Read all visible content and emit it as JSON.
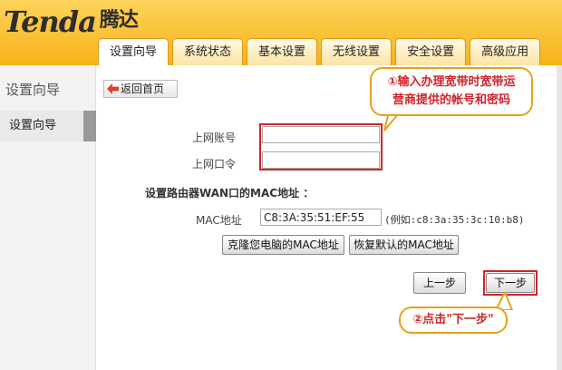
{
  "header": {
    "logo_text": "Tenda",
    "logo_cn": "腾达",
    "tabs": [
      {
        "label": "设置向导",
        "active": true
      },
      {
        "label": "系统状态"
      },
      {
        "label": "基本设置"
      },
      {
        "label": "无线设置"
      },
      {
        "label": "安全设置"
      },
      {
        "label": "高级应用"
      }
    ]
  },
  "sidebar": {
    "title": "设置向导",
    "items": [
      {
        "label": "设置向导",
        "active": true
      }
    ]
  },
  "main": {
    "back_button": "返回首页",
    "account_label": "上网账号",
    "account_value": "",
    "password_label": "上网口令",
    "password_value": "",
    "mac_section_title": "设置路由器WAN口的MAC地址 ：",
    "mac_label": "MAC地址",
    "mac_value": "C8:3A:35:51:EF:55",
    "mac_example": "(例如:c8:3a:35:3c:10:b8)",
    "clone_mac_button": "克隆您电脑的MAC地址",
    "restore_mac_button": "恢复默认的MAC地址",
    "prev_button": "上一步",
    "next_button": "下一步"
  },
  "annotations": {
    "callout1_line1": "①输入办理宽带时宽带运",
    "callout1_line2": "营商提供的帐号和密码",
    "callout2": "②点击\"下一步\""
  },
  "colors": {
    "header_bg": "#f7b21a",
    "highlight_red": "#d0232a",
    "callout_border": "#e8a11e"
  }
}
